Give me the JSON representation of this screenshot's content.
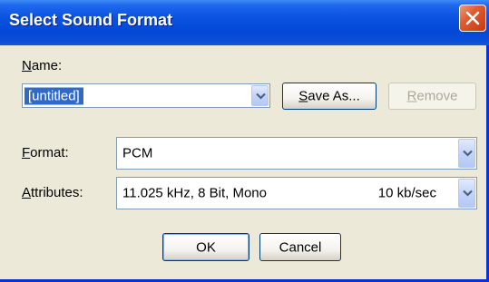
{
  "dialog": {
    "title": "Select Sound Format"
  },
  "name_row": {
    "label_underlined": "N",
    "label_rest": "ame:",
    "value": "[untitled]",
    "save_as_underlined": "S",
    "save_as_rest": "ave As...",
    "remove_underlined": "R",
    "remove_rest": "emove"
  },
  "format_row": {
    "label_underlined": "F",
    "label_rest": "ormat:",
    "value": "PCM"
  },
  "attributes_row": {
    "label_underlined": "A",
    "label_rest": "ttributes:",
    "value": "11.025 kHz, 8 Bit, Mono",
    "rate": "10 kb/sec"
  },
  "buttons": {
    "ok": "OK",
    "cancel": "Cancel"
  },
  "colors": {
    "titlebar": "#0A52E0",
    "face": "#ECE9D8",
    "selection": "#316AC5",
    "close": "#E15A2F"
  }
}
